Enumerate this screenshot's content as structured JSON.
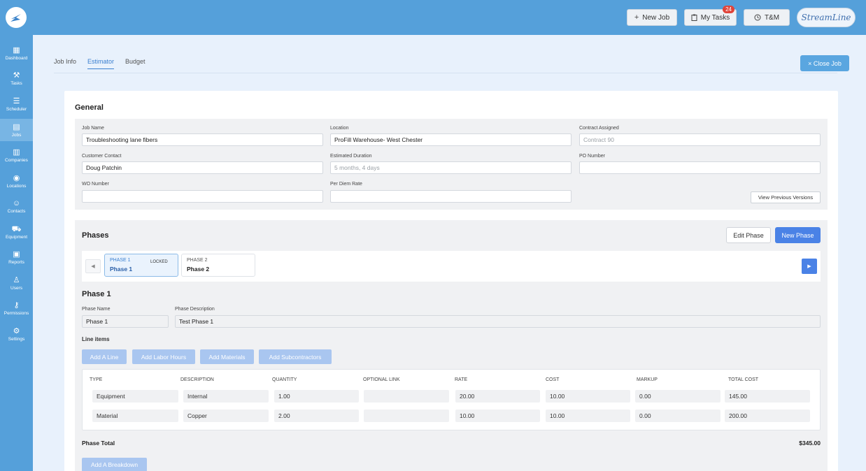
{
  "topbar": {
    "new_job": "New Job",
    "my_tasks": "My Tasks",
    "tasks_count": "24",
    "tm": "T&M",
    "brand": "StreamLine"
  },
  "sidebar": {
    "items": [
      {
        "label": "Dashboard",
        "icon": "dashboard-icon"
      },
      {
        "label": "Tasks",
        "icon": "wrench-icon"
      },
      {
        "label": "Scheduler",
        "icon": "checklist-icon"
      },
      {
        "label": "Jobs",
        "icon": "calendar-icon"
      },
      {
        "label": "Companies",
        "icon": "building-icon"
      },
      {
        "label": "Locations",
        "icon": "pin-icon"
      },
      {
        "label": "Contacts",
        "icon": "people-icon"
      },
      {
        "label": "Equipment",
        "icon": "truck-icon"
      },
      {
        "label": "Reports",
        "icon": "clipboard-icon"
      },
      {
        "label": "Users",
        "icon": "user-icon"
      },
      {
        "label": "Permissions",
        "icon": "key-icon"
      },
      {
        "label": "Settings",
        "icon": "gear-icon"
      }
    ],
    "active": "Jobs"
  },
  "tabs": {
    "job_info": "Job Info",
    "estimator": "Estimator",
    "budget": "Budget",
    "active": "Estimator"
  },
  "close_job": "× Close Job",
  "general": {
    "title": "General",
    "job_name_label": "Job Name",
    "job_name": "Troubleshooting lane fibers",
    "location_label": "Location",
    "location": "ProFill Warehouse- West Chester",
    "contract_label": "Contract Assigned",
    "contract_placeholder": "Contract 90",
    "customer_label": "Customer Contact",
    "customer": "Doug Patchin",
    "duration_label": "Estimated Duration",
    "duration_placeholder": "5 months, 4 days",
    "po_label": "PO Number",
    "po": "",
    "wo_label": "WO Number",
    "wo": "",
    "perdiem_label": "Per Diem Rate",
    "perdiem": "",
    "view_prev": "View Previous Versions"
  },
  "phases": {
    "title": "Phases",
    "edit_phase": "Edit Phase",
    "new_phase": "New Phase",
    "cards": [
      {
        "tag": "PHASE 1",
        "name": "Phase 1",
        "locked": "LOCKED"
      },
      {
        "tag": "PHASE 2",
        "name": "Phase 2"
      }
    ],
    "detail_title": "Phase 1",
    "name_label": "Phase Name",
    "name": "Phase 1",
    "desc_label": "Phase Description",
    "desc": "Test Phase 1",
    "line_items_label": "Line items",
    "buttons": {
      "add_line": "Add A Line",
      "add_labor": "Add Labor Hours",
      "add_materials": "Add Materials",
      "add_subs": "Add Subcontractors"
    },
    "table": {
      "headers": [
        "TYPE",
        "DESCRIPTION",
        "QUANTITY",
        "OPTIONAL LINK",
        "RATE",
        "COST",
        "MARKUP",
        "TOTAL COST"
      ],
      "rows": [
        [
          "Equipment",
          "Internal",
          "1.00",
          "",
          "20.00",
          "10.00",
          "0.00",
          "145.00"
        ],
        [
          "Material",
          "Copper",
          "2.00",
          "",
          "10.00",
          "10.00",
          "0.00",
          "200.00"
        ]
      ]
    },
    "total_label": "Phase Total",
    "total_value": "$345.00",
    "add_breakdown": "Add A Breakdown"
  },
  "colors": {
    "topbar": "#55a0da",
    "accent": "#4a82e6",
    "badge": "#e0443a"
  }
}
